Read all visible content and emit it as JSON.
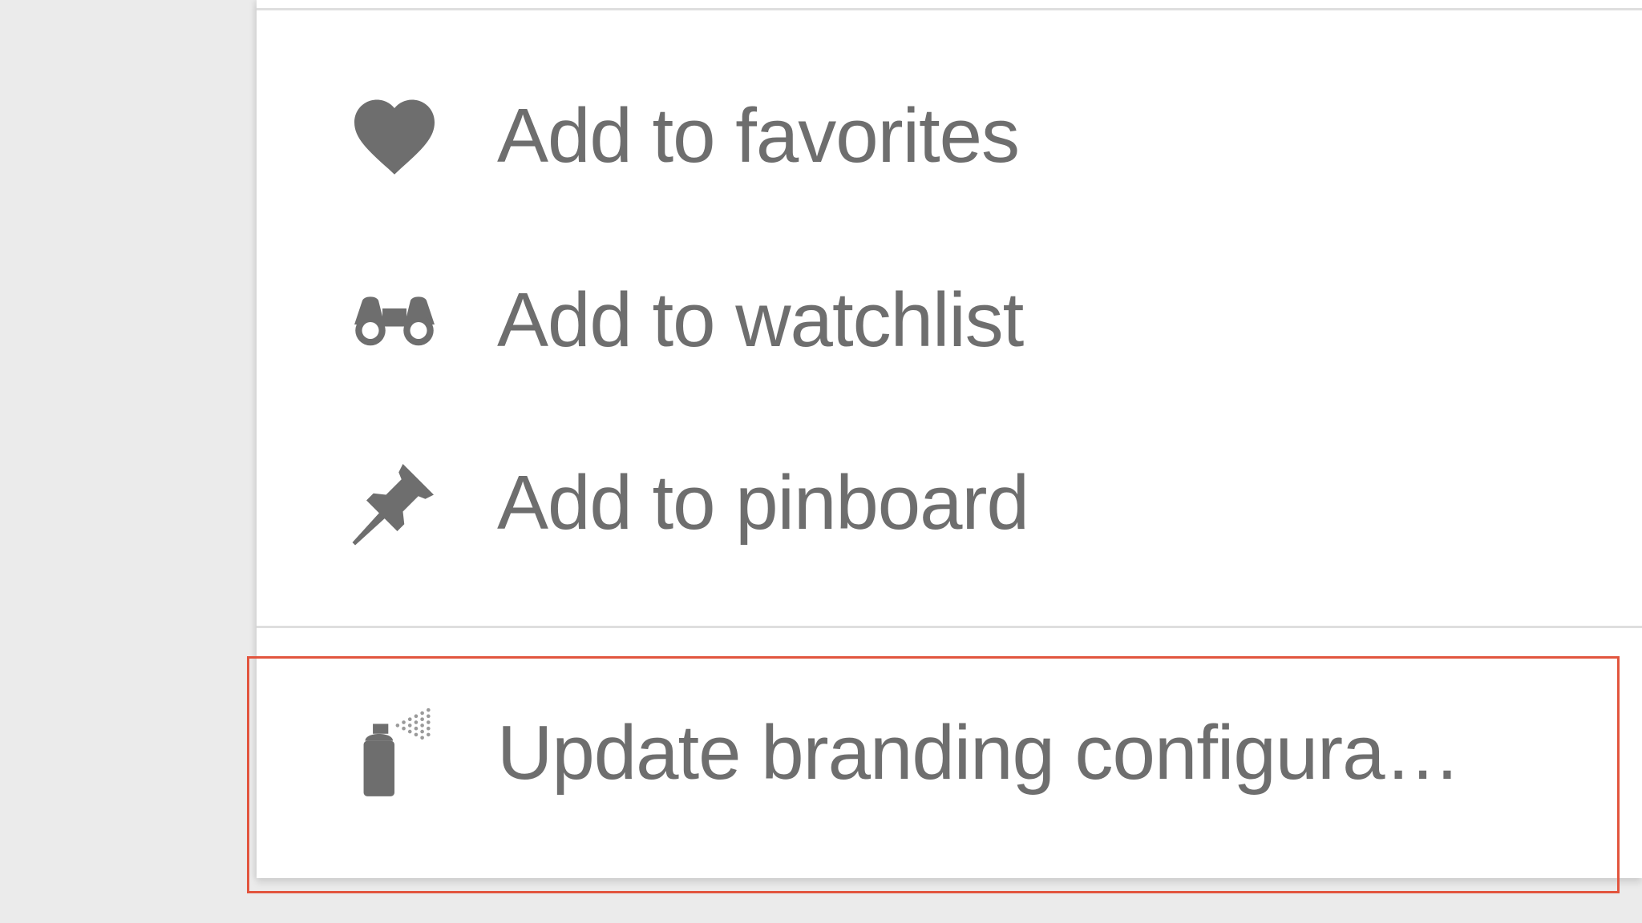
{
  "menu": {
    "items": [
      {
        "id": "favorites",
        "label": "Add to favorites",
        "icon": "heart-icon"
      },
      {
        "id": "watchlist",
        "label": "Add to watchlist",
        "icon": "binoculars-icon"
      },
      {
        "id": "pinboard",
        "label": "Add to pinboard",
        "icon": "pushpin-icon"
      },
      {
        "id": "branding",
        "label": "Update branding configura…",
        "icon": "spray-can-icon",
        "highlighted": true
      }
    ]
  },
  "colors": {
    "icon": "#6e6e6e",
    "label": "#6e6e6e",
    "panel": "#ffffff",
    "background": "#ebebeb",
    "highlight_border": "#e2553e"
  }
}
